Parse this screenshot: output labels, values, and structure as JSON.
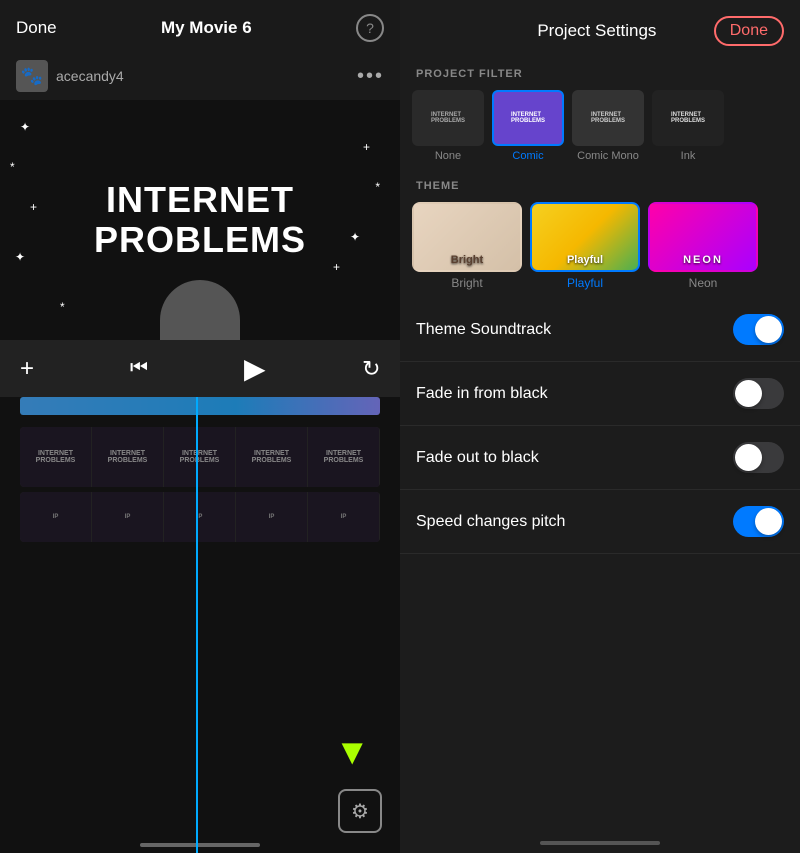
{
  "left": {
    "done_label": "Done",
    "title": "My Movie 6",
    "help_icon": "?",
    "username": "acecandy4",
    "dots": "•••",
    "video_text_line1": "INTERNET",
    "video_text_line2": "PROBLEMS",
    "controls": {
      "add_label": "+",
      "back_label": "⏮",
      "play_label": "▶",
      "undo_label": "↺"
    },
    "settings_icon": "⚙"
  },
  "right": {
    "title": "Project Settings",
    "done_label": "Done",
    "sections": {
      "filter_label": "PROJECT FILTER",
      "theme_label": "THEME"
    },
    "filters": [
      {
        "id": "none",
        "label": "None",
        "selected": false
      },
      {
        "id": "comic",
        "label": "Comic",
        "selected": true
      },
      {
        "id": "comicmono",
        "label": "Comic Mono",
        "selected": false
      },
      {
        "id": "ink",
        "label": "Ink",
        "selected": false
      }
    ],
    "themes": [
      {
        "id": "bright",
        "label": "Bright",
        "selected": false,
        "thumb_label": "Bright"
      },
      {
        "id": "playful",
        "label": "Playful",
        "selected": true,
        "thumb_label": "Playful"
      },
      {
        "id": "neon",
        "label": "Neon",
        "selected": false,
        "thumb_label": "NEON"
      }
    ],
    "toggles": [
      {
        "id": "theme-soundtrack",
        "label": "Theme Soundtrack",
        "on": true
      },
      {
        "id": "fade-in",
        "label": "Fade in from black",
        "on": false
      },
      {
        "id": "fade-out",
        "label": "Fade out to black",
        "on": false
      },
      {
        "id": "speed-pitch",
        "label": "Speed changes pitch",
        "on": true
      }
    ]
  }
}
